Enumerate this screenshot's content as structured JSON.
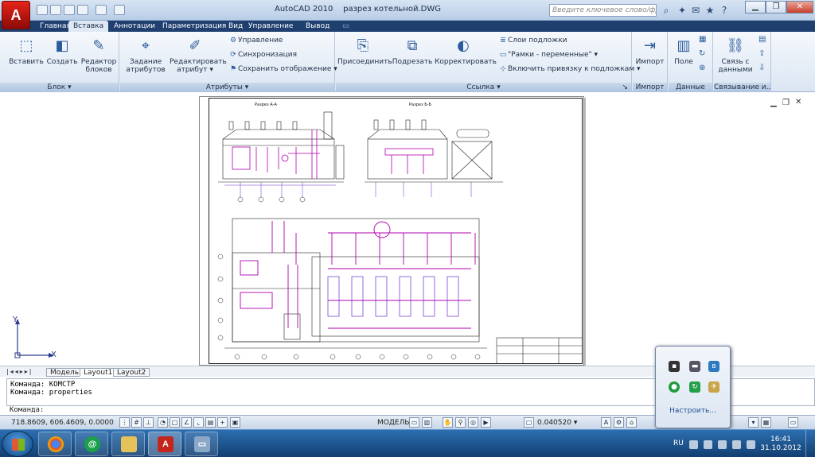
{
  "window": {
    "app_logo": "A",
    "title_app": "AutoCAD 2010",
    "title_file": "разрез котельной.DWG",
    "search_placeholder": "Введите ключевое слово/фразу"
  },
  "tabs": [
    {
      "label": "Главная",
      "active": false
    },
    {
      "label": "Вставка",
      "active": true
    },
    {
      "label": "Аннотации",
      "active": false
    },
    {
      "label": "Параметризация",
      "active": false
    },
    {
      "label": "Вид",
      "active": false
    },
    {
      "label": "Управление",
      "active": false
    },
    {
      "label": "Вывод",
      "active": false
    }
  ],
  "ribbon": {
    "block_panel": {
      "title": "Блок",
      "insert": "Вставить",
      "create": "Создать",
      "editor": "Редактор блоков"
    },
    "attr_panel": {
      "title": "Атрибуты",
      "define": "Задание атрибутов",
      "edit": "Редактировать атрибут",
      "manage": "Управление",
      "sync": "Синхронизация",
      "save_display": "Сохранить отображение"
    },
    "ref_panel": {
      "title": "Ссылка",
      "attach": "Присоединить",
      "clip": "Подрезать",
      "adjust": "Корректировать",
      "underlay_layers": "Слои подложки",
      "frames": "\"Рамки - переменные\"",
      "snap": "Включить привязку к подложкам"
    },
    "import_panel": {
      "title": "Импорт",
      "import": "Импорт"
    },
    "data_panel": {
      "title": "Данные",
      "field": "Поле"
    },
    "link_panel": {
      "title": "Связывание и...",
      "link": "Связь с данными"
    }
  },
  "drawing": {
    "section_a": "Разрез А-А",
    "section_b": "Разрез Б-Б"
  },
  "ucs": {
    "x": "X",
    "y": "Y"
  },
  "layout_tabs": [
    "Модель",
    "Layout1",
    "Layout2"
  ],
  "layout_active": "Layout1",
  "command": {
    "history": [
      "Команда: КОМСТР",
      "Команда: properties"
    ],
    "prompt": "Команда:"
  },
  "status": {
    "coords": "718.8609, 606.4609, 0.0000",
    "model": "МОДЕЛЬ",
    "scale": "0.040520"
  },
  "tray": {
    "customize": "Настроить...",
    "lang": "RU",
    "time": "16:41",
    "date": "31.10.2012"
  },
  "colors": {
    "accent_tab": "#1f3f6f",
    "drawing_magenta": "#b000b0",
    "drawing_violet": "#6a2bd0"
  }
}
